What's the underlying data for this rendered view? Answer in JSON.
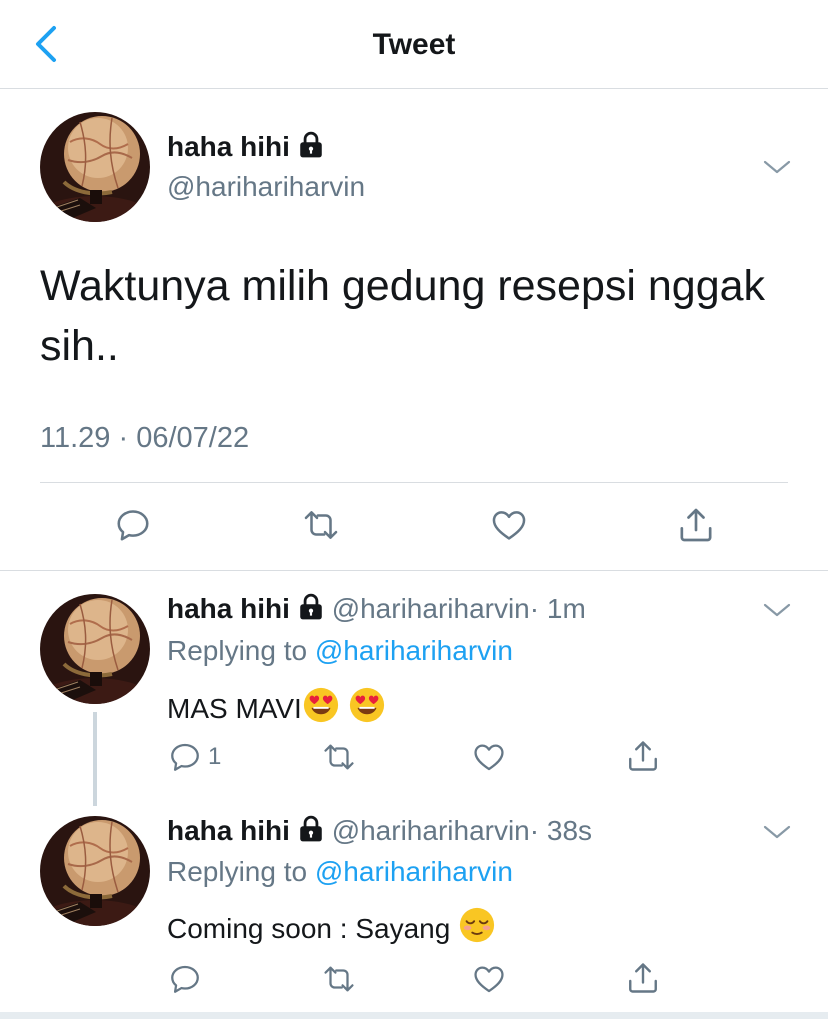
{
  "header": {
    "title": "Tweet"
  },
  "main_tweet": {
    "name": "haha hihi",
    "handle": "@harihariharvin",
    "text": "Waktunya milih gedung resepsi nggak sih..",
    "timestamp": "11.29 · 06/07/22"
  },
  "replies": [
    {
      "name": "haha hihi",
      "handle": "@harihariharvin",
      "time": "· 1m",
      "replying_label": "Replying to",
      "replying_to": "@harihariharvin",
      "text": "MAS MAVI",
      "emoji": [
        "heart-eyes-emoji",
        "heart-eyes-emoji"
      ],
      "reply_count": "1"
    },
    {
      "name": "haha hihi",
      "handle": "@harihariharvin",
      "time": "· 38s",
      "replying_label": "Replying to",
      "replying_to": "@harihariharvin",
      "text": "Coming soon : Sayang",
      "emoji": [
        "relieved-face-emoji"
      ],
      "reply_count": ""
    }
  ],
  "icons": {
    "back": "chevron-left-icon",
    "menu": "chevron-down-icon",
    "lock": "lock-icon",
    "reply": "reply-icon",
    "retweet": "retweet-icon",
    "like": "heart-icon",
    "share": "share-icon"
  },
  "colors": {
    "accent": "#1da1f2",
    "muted": "#657786",
    "divider": "#d9dde1",
    "icon": "#657786"
  }
}
